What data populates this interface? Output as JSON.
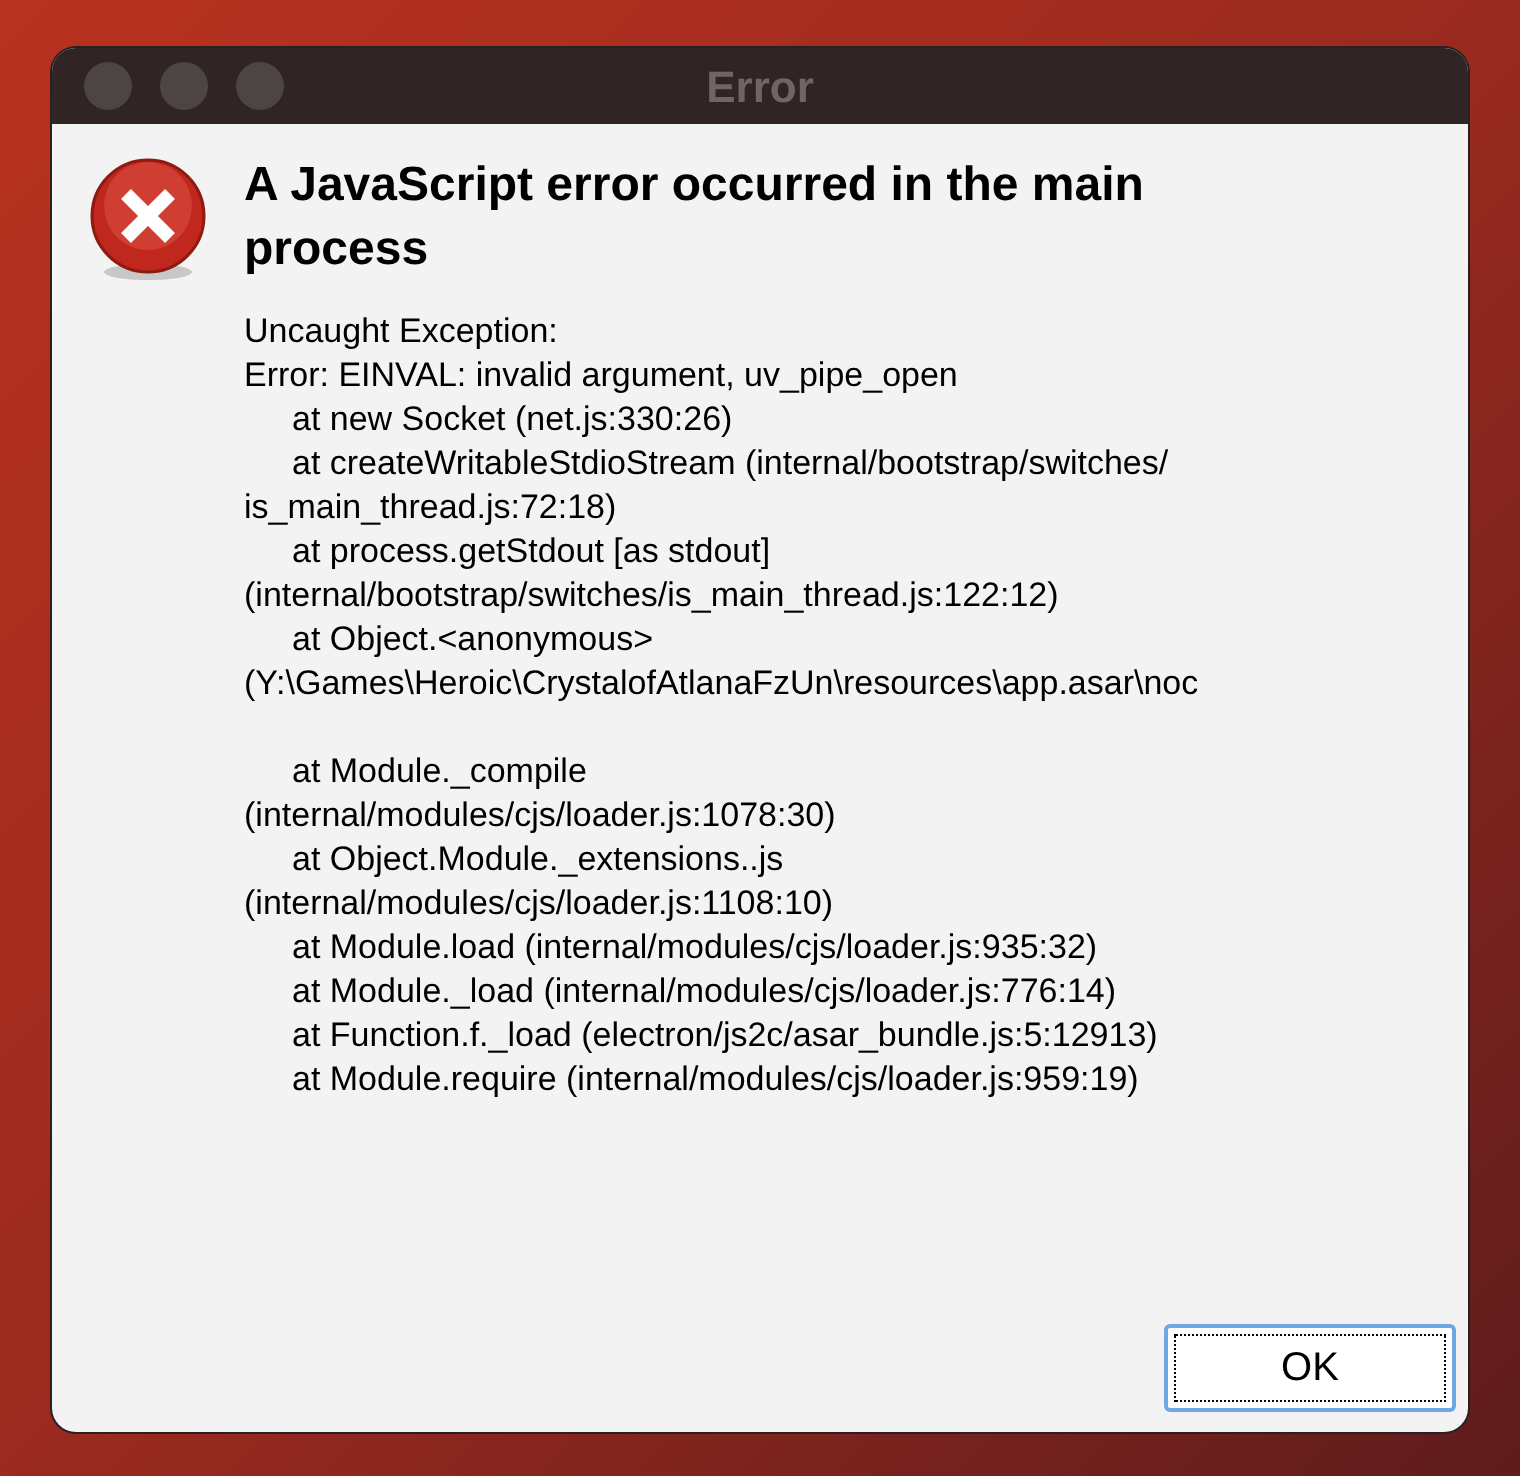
{
  "window": {
    "title": "Error"
  },
  "dialog": {
    "heading": "A JavaScript error occurred in the main process",
    "blocks": [
      {
        "lines": [
          {
            "text": "Uncaught Exception:",
            "indent": false
          },
          {
            "text": "Error: EINVAL: invalid argument, uv_pipe_open",
            "indent": false
          },
          {
            "text": "at new Socket (net.js:330:26)",
            "indent": true
          },
          {
            "text": "at createWritableStdioStream (internal/bootstrap/switches/",
            "indent": true
          },
          {
            "text": "is_main_thread.js:72:18)",
            "indent": false
          },
          {
            "text": "at process.getStdout [as stdout]",
            "indent": true
          },
          {
            "text": "(internal/bootstrap/switches/is_main_thread.js:122:12)",
            "indent": false
          },
          {
            "text": "at Object.<anonymous>",
            "indent": true
          },
          {
            "text": "(Y:\\Games\\Heroic\\CrystalofAtlanaFzUn\\resources\\app.asar\\noc",
            "indent": false
          }
        ]
      },
      {
        "lines": [
          {
            "text": "at Module._compile",
            "indent": true
          },
          {
            "text": "(internal/modules/cjs/loader.js:1078:30)",
            "indent": false
          },
          {
            "text": "at Object.Module._extensions..js",
            "indent": true
          },
          {
            "text": "(internal/modules/cjs/loader.js:1108:10)",
            "indent": false
          },
          {
            "text": "at Module.load (internal/modules/cjs/loader.js:935:32)",
            "indent": true
          },
          {
            "text": "at Module._load (internal/modules/cjs/loader.js:776:14)",
            "indent": true
          },
          {
            "text": "at Function.f._load (electron/js2c/asar_bundle.js:5:12913)",
            "indent": true
          },
          {
            "text": "at Module.require (internal/modules/cjs/loader.js:959:19)",
            "indent": true
          }
        ]
      }
    ],
    "buttons": [
      "OK"
    ]
  }
}
